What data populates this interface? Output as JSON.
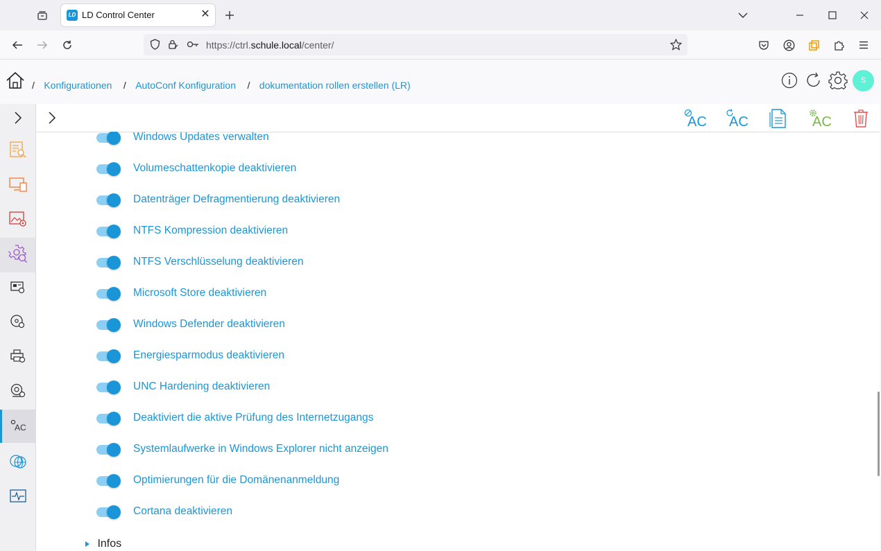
{
  "browser": {
    "tab_title": "LD Control Center",
    "tab_favicon_text": "LD",
    "url_prefix": "https://ctrl.",
    "url_host": "schule.local",
    "url_path": "/center/"
  },
  "breadcrumb": {
    "items": [
      "Konfigurationen",
      "AutoConf Konfiguration",
      "dokumentation rollen erstellen (LR)"
    ],
    "separator": "/"
  },
  "header": {
    "avatar_letter": "S",
    "avatar_color": "#5ff0d8"
  },
  "accent_color": "#1a96d8",
  "sidebar": {
    "items": [
      {
        "name": "expand",
        "icon": "chevron-right-icon"
      },
      {
        "name": "reports",
        "icon": "report-search-icon"
      },
      {
        "name": "devices",
        "icon": "devices-icon"
      },
      {
        "name": "images",
        "icon": "image-settings-icon"
      },
      {
        "name": "configuration",
        "icon": "gear-search-icon",
        "active": true
      },
      {
        "name": "hardware",
        "icon": "hardware-settings-icon"
      },
      {
        "name": "disks",
        "icon": "disk-settings-icon"
      },
      {
        "name": "printers",
        "icon": "printer-settings-icon"
      },
      {
        "name": "webcam",
        "icon": "webcam-settings-icon"
      },
      {
        "name": "autoconf",
        "icon": "autoconf-icon",
        "label": "AC",
        "selected": true
      },
      {
        "name": "network",
        "icon": "globe-gear-icon"
      },
      {
        "name": "monitoring",
        "icon": "monitor-pulse-icon"
      }
    ]
  },
  "toolbar": {
    "ac_label": "AC"
  },
  "options": [
    {
      "label": "Windows Updates verwalten",
      "enabled": true
    },
    {
      "label": "Volumeschattenkopie deaktivieren",
      "enabled": true
    },
    {
      "label": "Datenträger Defragmentierung deaktivieren",
      "enabled": true
    },
    {
      "label": "NTFS Kompression deaktivieren",
      "enabled": true
    },
    {
      "label": "NTFS Verschlüsselung deaktivieren",
      "enabled": true
    },
    {
      "label": "Microsoft Store deaktivieren",
      "enabled": true
    },
    {
      "label": "Windows Defender deaktivieren",
      "enabled": true
    },
    {
      "label": "Energiesparmodus deaktivieren",
      "enabled": true
    },
    {
      "label": "UNC Hardening deaktivieren",
      "enabled": true
    },
    {
      "label": "Deaktiviert die aktive Prüfung des Internetzugangs",
      "enabled": true
    },
    {
      "label": "Systemlaufwerke in Windows Explorer nicht anzeigen",
      "enabled": true
    },
    {
      "label": "Optimierungen für die Domänenanmeldung",
      "enabled": true
    },
    {
      "label": "Cortana deaktivieren",
      "enabled": true
    }
  ],
  "section": {
    "infos_label": "Infos"
  }
}
